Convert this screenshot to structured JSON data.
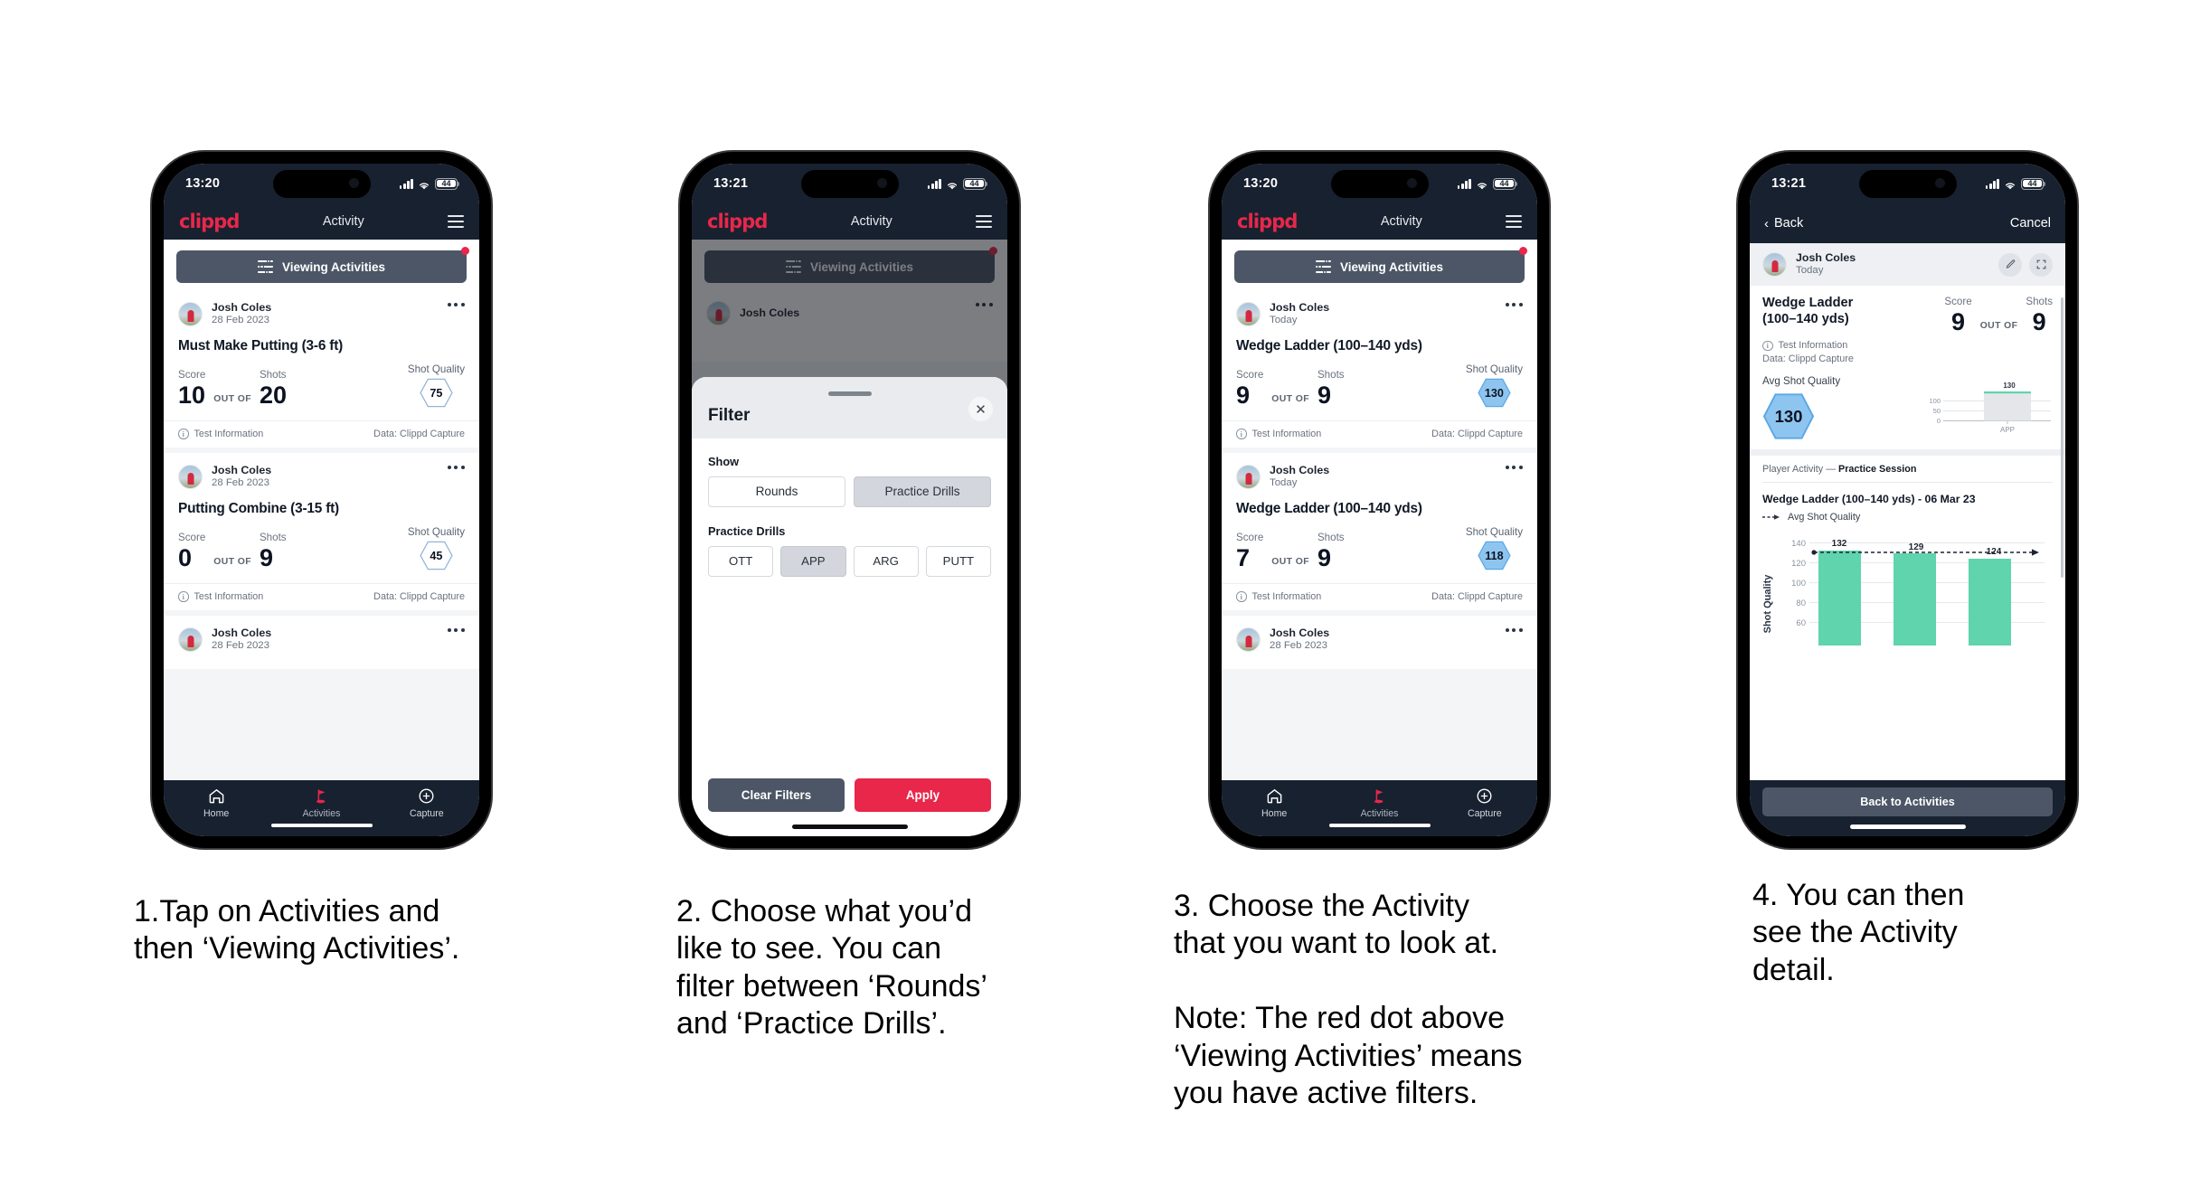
{
  "accent": {
    "brand_red": "#e8274b",
    "dark_navy": "#18212f",
    "slate": "#4c5666",
    "mint": "#5fd4ad",
    "hex_blue": "#8ec5f0"
  },
  "brand": "clippd",
  "phones": [
    {
      "id": "phone-1",
      "status": {
        "time": "13:20",
        "battery": "44"
      },
      "appbar": {
        "title": "Activity"
      },
      "viewing": {
        "label": "Viewing Activities",
        "has_red_dot": true
      },
      "cards": [
        {
          "user": "Josh Coles",
          "date": "28 Feb 2023",
          "title": "Must Make Putting (3-6 ft)",
          "score_label": "Score",
          "score": "10",
          "outof": "OUT OF",
          "shots_label": "Shots",
          "shots": "20",
          "sq_label": "Shot Quality",
          "sq": "75",
          "sq_filled": false,
          "foot_left": "Test Information",
          "foot_right": "Data: Clippd Capture"
        },
        {
          "user": "Josh Coles",
          "date": "28 Feb 2023",
          "title": "Putting Combine (3-15 ft)",
          "score_label": "Score",
          "score": "0",
          "outof": "OUT OF",
          "shots_label": "Shots",
          "shots": "9",
          "sq_label": "Shot Quality",
          "sq": "45",
          "sq_filled": false,
          "foot_left": "Test Information",
          "foot_right": "Data: Clippd Capture"
        },
        {
          "user": "Josh Coles",
          "date": "28 Feb 2023",
          "partial": true
        }
      ],
      "nav": [
        {
          "label": "Home",
          "icon": "home-icon",
          "active": false
        },
        {
          "label": "Activities",
          "icon": "golf-flag-icon",
          "active": true
        },
        {
          "label": "Capture",
          "icon": "plus-circle-icon",
          "active": false
        }
      ],
      "caption": "1.Tap on Activities and\nthen ‘Viewing Activities’."
    },
    {
      "id": "phone-2",
      "status": {
        "time": "13:21",
        "battery": "44"
      },
      "appbar": {
        "title": "Activity"
      },
      "viewing": {
        "label": "Viewing Activities",
        "has_red_dot": true
      },
      "behind_card": {
        "user": "Josh Coles"
      },
      "sheet": {
        "title": "Filter",
        "close_icon": "close-icon",
        "show_label": "Show",
        "show_options": [
          {
            "label": "Rounds",
            "selected": false
          },
          {
            "label": "Practice Drills",
            "selected": true
          }
        ],
        "drills_label": "Practice Drills",
        "drill_options": [
          {
            "label": "OTT",
            "selected": false
          },
          {
            "label": "APP",
            "selected": true
          },
          {
            "label": "ARG",
            "selected": false
          },
          {
            "label": "PUTT",
            "selected": false
          }
        ],
        "clear_label": "Clear Filters",
        "apply_label": "Apply"
      },
      "caption": "2. Choose what you’d\nlike to see. You can\nfilter between ‘Rounds’\nand ‘Practice Drills’."
    },
    {
      "id": "phone-3",
      "status": {
        "time": "13:20",
        "battery": "44"
      },
      "appbar": {
        "title": "Activity"
      },
      "viewing": {
        "label": "Viewing Activities",
        "has_red_dot": true
      },
      "cards": [
        {
          "user": "Josh Coles",
          "date": "Today",
          "title": "Wedge Ladder (100–140 yds)",
          "score_label": "Score",
          "score": "9",
          "outof": "OUT OF",
          "shots_label": "Shots",
          "shots": "9",
          "sq_label": "Shot Quality",
          "sq": "130",
          "sq_filled": true,
          "foot_left": "Test Information",
          "foot_right": "Data: Clippd Capture"
        },
        {
          "user": "Josh Coles",
          "date": "Today",
          "title": "Wedge Ladder (100–140 yds)",
          "score_label": "Score",
          "score": "7",
          "outof": "OUT OF",
          "shots_label": "Shots",
          "shots": "9",
          "sq_label": "Shot Quality",
          "sq": "118",
          "sq_filled": true,
          "foot_left": "Test Information",
          "foot_right": "Data: Clippd Capture"
        },
        {
          "user": "Josh Coles",
          "date": "28 Feb 2023",
          "partial": true
        }
      ],
      "nav": [
        {
          "label": "Home",
          "icon": "home-icon",
          "active": false
        },
        {
          "label": "Activities",
          "icon": "golf-flag-icon",
          "active": true
        },
        {
          "label": "Capture",
          "icon": "plus-circle-icon",
          "active": false
        }
      ],
      "caption": "3. Choose the Activity\nthat you want to look at.\n\nNote: The red dot above\n‘Viewing Activities’ means\nyou have active filters."
    },
    {
      "id": "phone-4",
      "status": {
        "time": "13:21",
        "battery": "44"
      },
      "detailbar": {
        "back": "Back",
        "cancel": "Cancel"
      },
      "user_row": {
        "user": "Josh Coles",
        "date": "Today",
        "edit_icon": "pencil-icon",
        "expand_icon": "fullscreen-icon"
      },
      "detail": {
        "name": "Wedge Ladder\n(100–140 yds)",
        "score_label": "Score",
        "score": "9",
        "outof": "OUT OF",
        "shots_label": "Shots",
        "shots": "9",
        "info_line": "Test Information",
        "data_line": "Data: Clippd Capture",
        "avg_label": "Avg Shot Quality",
        "avg_value": "130",
        "player_activity_prefix": "Player Activity —",
        "player_activity_value": "Practice Session",
        "chart_title": "Wedge Ladder (100–140 yds) - 06 Mar 23",
        "legend_label": "Avg Shot Quality",
        "back_button": "Back to Activities"
      },
      "caption": "4. You can then\nsee the Activity\ndetail."
    }
  ],
  "chart_data": [
    {
      "type": "bar",
      "title": "Avg Shot Quality",
      "categories": [
        "APP"
      ],
      "values": [
        130
      ],
      "data_labels": [
        "130"
      ],
      "ylabel": "",
      "ytick_labels": [
        "0",
        "50",
        "100"
      ],
      "yticks": [
        0,
        50,
        100
      ],
      "ylim": [
        0,
        140
      ],
      "grid": true,
      "legend": "none",
      "bar_color": "#e4e6e9",
      "cap_color": "#5fd4ad"
    },
    {
      "type": "bar",
      "title": "Wedge Ladder (100–140 yds) - 06 Mar 23",
      "categories": [
        "1",
        "2",
        "3"
      ],
      "values": [
        132,
        129,
        124
      ],
      "data_labels": [
        "132",
        "129",
        "124"
      ],
      "ylabel": "Shot Quality",
      "ytick_labels": [
        "60",
        "80",
        "100",
        "120",
        "140"
      ],
      "yticks": [
        60,
        80,
        100,
        120,
        140
      ],
      "ylim": [
        50,
        148
      ],
      "grid": true,
      "legend": "Avg Shot Quality",
      "legend_position": "top-left",
      "avg_line": 130,
      "bar_color": "#5fd4ad"
    }
  ]
}
